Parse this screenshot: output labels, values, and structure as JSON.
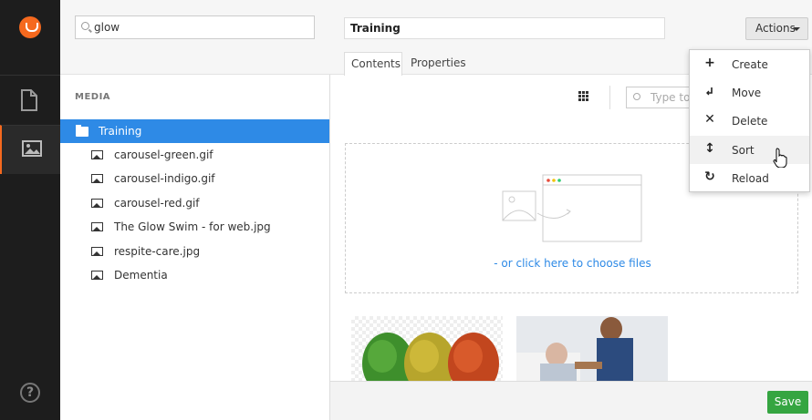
{
  "sidebar": {
    "icons": [
      "logo-icon",
      "document-icon",
      "media-icon",
      "help-icon"
    ]
  },
  "tree": {
    "search_value": "glow",
    "section_label": "MEDIA",
    "root": "Training",
    "children": [
      "carousel-green.gif",
      "carousel-indigo.gif",
      "carousel-red.gif",
      "The Glow Swim - for web.jpg",
      "respite-care.jpg",
      "Dementia"
    ]
  },
  "editor": {
    "name_value": "Training",
    "actions_label": "Actions",
    "tabs": [
      "Contents",
      "Properties"
    ],
    "search_placeholder": "Type to",
    "dropzone_link": "- or click here to choose files",
    "save_label": "Save"
  },
  "menu": {
    "items": [
      {
        "label": "Create",
        "icon": "plus-icon"
      },
      {
        "label": "Move",
        "icon": "move-icon"
      },
      {
        "label": "Delete",
        "icon": "delete-icon"
      },
      {
        "label": "Sort",
        "icon": "sort-icon"
      },
      {
        "label": "Reload",
        "icon": "reload-icon"
      }
    ]
  },
  "colors": {
    "accent": "#2e8ae6",
    "brand": "#f5691e",
    "save": "#35a541",
    "rail": "#1d1d1d"
  }
}
